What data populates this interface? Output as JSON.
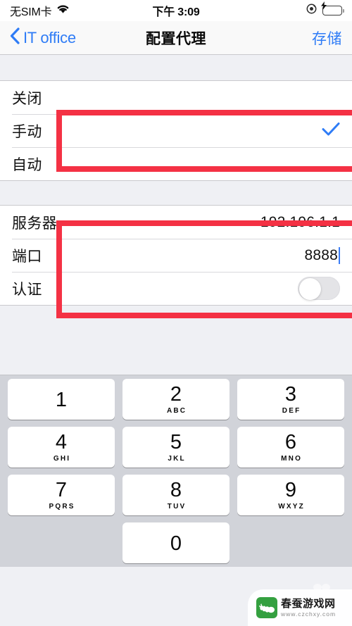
{
  "status_bar": {
    "carrier": "无SIM卡",
    "wifi_icon": "wifi-icon",
    "time": "下午 3:09",
    "location_icon": "location-icon",
    "battery_icon": "battery-charging-icon"
  },
  "nav_bar": {
    "back_icon": "chevron-left-icon",
    "back_label": "IT office",
    "title": "配置代理",
    "save_label": "存储"
  },
  "proxy_mode_section": {
    "rows": [
      {
        "label": "关闭",
        "selected": false
      },
      {
        "label": "手动",
        "selected": true
      },
      {
        "label": "自动",
        "selected": false
      }
    ],
    "checkmark_icon": "checkmark-icon"
  },
  "proxy_settings_section": {
    "server": {
      "label": "服务器",
      "value": "192.196.1.1"
    },
    "port": {
      "label": "端口",
      "value": "8888",
      "cursor": true
    },
    "auth": {
      "label": "认证",
      "toggle_state": "off"
    }
  },
  "annotations": [
    {
      "name": "highlight-manual-row",
      "color": "#f43144"
    },
    {
      "name": "highlight-server-port-rows",
      "color": "#f43144"
    }
  ],
  "keyboard": {
    "type": "numeric-pad",
    "keys": [
      {
        "digit": "1",
        "letters": ""
      },
      {
        "digit": "2",
        "letters": "ABC"
      },
      {
        "digit": "3",
        "letters": "DEF"
      },
      {
        "digit": "4",
        "letters": "GHI"
      },
      {
        "digit": "5",
        "letters": "JKL"
      },
      {
        "digit": "6",
        "letters": "MNO"
      },
      {
        "digit": "7",
        "letters": "PQRS"
      },
      {
        "digit": "8",
        "letters": "TUV"
      },
      {
        "digit": "9",
        "letters": "WXYZ"
      },
      {
        "digit": "0",
        "letters": ""
      }
    ]
  },
  "watermark": {
    "logo_icon": "silkworm-logo-icon",
    "title": "春蚕游戏网",
    "url": "www.czchxy.com"
  },
  "colors": {
    "accent_blue": "#2f7cf6",
    "annotation_red": "#f43144",
    "battery_green": "#4cd964",
    "group_background": "#eff0f4",
    "keyboard_background": "#d1d3d9"
  }
}
